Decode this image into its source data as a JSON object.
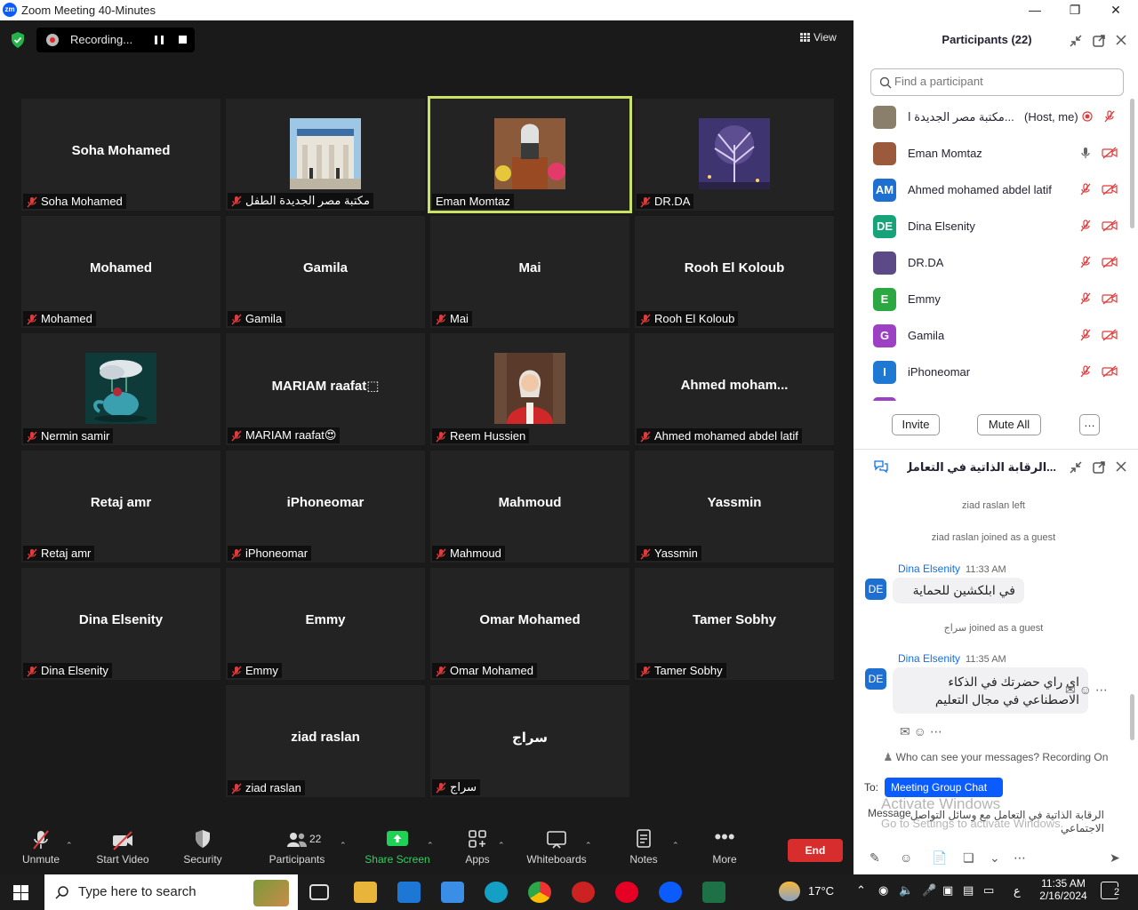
{
  "window": {
    "title": "Zoom Meeting 40-Minutes",
    "logo": "zm"
  },
  "recording": {
    "label": "Recording..."
  },
  "view_label": "View",
  "tiles": [
    {
      "name": "Soha Mohamed",
      "tag": "Soha Mohamed",
      "video": false
    },
    {
      "name": "",
      "tag": "مكتبة مصر الجديدة الطفل",
      "video": true,
      "photo": "library"
    },
    {
      "name": "",
      "tag": "Eman Momtaz",
      "video": true,
      "photo": "speaker",
      "active": true,
      "unmuted": true
    },
    {
      "name": "",
      "tag": "DR.DA",
      "video": true,
      "photo": "night"
    },
    {
      "name": "Mohamed",
      "tag": "Mohamed",
      "video": false
    },
    {
      "name": "Gamila",
      "tag": "Gamila",
      "video": false
    },
    {
      "name": "Mai",
      "tag": "Mai",
      "video": false
    },
    {
      "name": "Rooh El Koloub",
      "tag": "Rooh El Koloub",
      "video": false
    },
    {
      "name": "",
      "tag": "Nermin samir",
      "video": true,
      "photo": "teapot"
    },
    {
      "name": "MARIAM  raafat⬚",
      "tag": "MARIAM raafat😍",
      "video": false
    },
    {
      "name": "",
      "tag": "Reem Hussien",
      "video": true,
      "photo": "woman"
    },
    {
      "name": "Ahmed  moham...",
      "tag": "Ahmed mohamed abdel latif",
      "video": false
    },
    {
      "name": "Retaj amr",
      "tag": "Retaj amr",
      "video": false
    },
    {
      "name": "iPhoneomar",
      "tag": "iPhoneomar",
      "video": false
    },
    {
      "name": "Mahmoud",
      "tag": "Mahmoud",
      "video": false
    },
    {
      "name": "Yassmin",
      "tag": "Yassmin",
      "video": false
    },
    {
      "name": "Dina Elsenity",
      "tag": "Dina Elsenity",
      "video": false
    },
    {
      "name": "Emmy",
      "tag": "Emmy",
      "video": false
    },
    {
      "name": "Omar Mohamed",
      "tag": "Omar Mohamed",
      "video": false
    },
    {
      "name": "Tamer Sobhy",
      "tag": "Tamer Sobhy",
      "video": false
    },
    {
      "name": "ziad raslan",
      "tag": "ziad raslan",
      "video": false
    },
    {
      "name": "سراج",
      "tag": "سراج",
      "video": false
    }
  ],
  "toolbar": {
    "unmute": "Unmute",
    "start_video": "Start Video",
    "security": "Security",
    "participants": "Participants",
    "participants_count": "22",
    "share_screen": "Share Screen",
    "apps": "Apps",
    "whiteboards": "Whiteboards",
    "notes": "Notes",
    "more": "More",
    "end": "End"
  },
  "participants_panel": {
    "title": "Participants (22)",
    "search_placeholder": "Find a participant",
    "invite": "Invite",
    "mute_all": "Mute All",
    "more": "…",
    "list": [
      {
        "name": "مكتبة مصر الجديدة ا...",
        "role": "(Host, me)",
        "initials": "",
        "color": "#8a7f6b"
      },
      {
        "name": "Eman Momtaz",
        "role": "",
        "initials": "",
        "color": "#9c5a3c"
      },
      {
        "name": "Ahmed mohamed abdel latif",
        "role": "",
        "initials": "AM",
        "color": "#1d6fd1"
      },
      {
        "name": "Dina Elsenity",
        "role": "",
        "initials": "DE",
        "color": "#17a37a"
      },
      {
        "name": "DR.DA",
        "role": "",
        "initials": "",
        "color": "#5b4a86"
      },
      {
        "name": "Emmy",
        "role": "",
        "initials": "E",
        "color": "#2ca843"
      },
      {
        "name": "Gamila",
        "role": "",
        "initials": "G",
        "color": "#9c40c4"
      },
      {
        "name": "iPhoneomar",
        "role": "",
        "initials": "I",
        "color": "#1f78d1"
      }
    ]
  },
  "chat": {
    "title": "...الرقابة الذاتية في التعامل مع",
    "events": [
      "ziad raslan left",
      "ziad raslan joined as a guest",
      "سراج joined as a guest"
    ],
    "messages": [
      {
        "sender": "Dina Elsenity",
        "time": "11:33 AM",
        "initials": "DE",
        "text": "في ابلكشين للحماية"
      },
      {
        "sender": "Dina Elsenity",
        "time": "11:35 AM",
        "initials": "DE",
        "text": "اي راي حضرتك في الذكاء الاصطناعي في مجال التعليم"
      }
    ],
    "who_can_see": "Who can see your messages? Recording On",
    "to_label": "To:",
    "to_value": "Meeting Group Chat",
    "message_label": "Message",
    "draft": "الرقابة الذاتية في التعامل مع وسائل التواصل الاجتماعي",
    "watermark_title": "Activate Windows",
    "watermark_sub": "Go to Settings to activate Windows."
  },
  "taskbar": {
    "search_placeholder": "Type here to search",
    "weather": "17°C",
    "lang": "ع",
    "time": "11:35 AM",
    "date": "2/16/2024",
    "notif_count": "2"
  }
}
